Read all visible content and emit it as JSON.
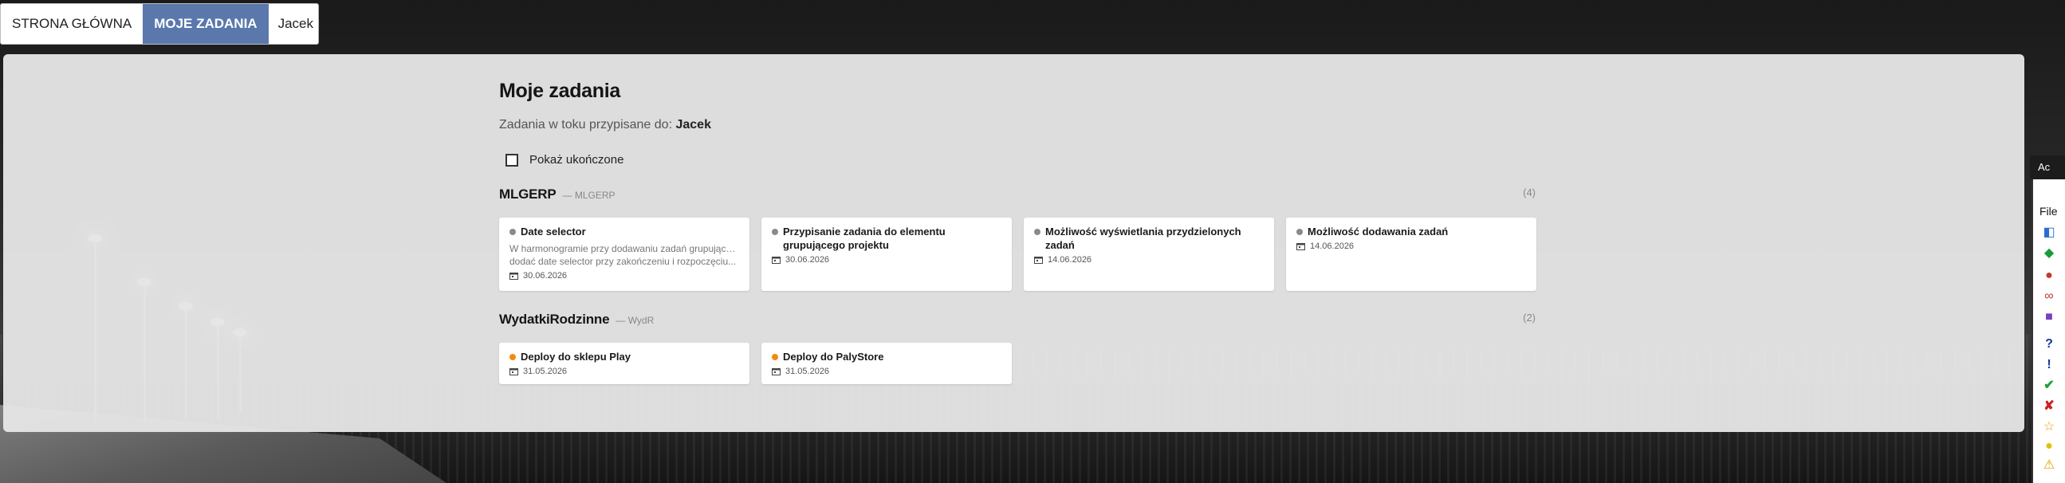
{
  "nav": {
    "home": "STRONA GŁÓWNA",
    "my_tasks": "MOJE ZADANIA",
    "user": "Jacek"
  },
  "page": {
    "title": "Moje zadania",
    "subtitle_prefix": "Zadania w toku przypisane do:",
    "assignee": "Jacek",
    "show_completed_label": "Pokaż ukończone",
    "show_completed_checked": false
  },
  "groups": [
    {
      "name": "MLGERP",
      "code": "— MLGERP",
      "count": "(4)",
      "tasks": [
        {
          "title": "Date selector",
          "desc_line1": "W harmonogramie przy dodawaniu zadań grupujących",
          "desc_line2": "dodać date selector przy zakończeniu i rozpoczęciu...",
          "date": "30.06.2026",
          "status_color": "#8a8a8a"
        },
        {
          "title": "Przypisanie zadania do elementu grupującego projektu",
          "date": "30.06.2026",
          "status_color": "#8a8a8a"
        },
        {
          "title": "Możliwość wyświetlania przydzielonych zadań",
          "date": "14.06.2026",
          "status_color": "#8a8a8a"
        },
        {
          "title": "Możliwość dodawania zadań",
          "date": "14.06.2026",
          "status_color": "#8a8a8a"
        }
      ]
    },
    {
      "name": "WydatkiRodzinne",
      "code": "— WydR",
      "count": "(2)",
      "tasks": [
        {
          "title": "Deploy do sklepu Play",
          "date": "31.05.2026",
          "status_color": "#f28c0f"
        },
        {
          "title": "Deploy do PalyStore",
          "date": "31.05.2026",
          "status_color": "#f28c0f"
        }
      ]
    }
  ],
  "side_strip": {
    "header": "Ac",
    "file_menu": "File"
  },
  "colors": {
    "nav_active": "#5b78ad",
    "panel": "#e5e5e5"
  }
}
